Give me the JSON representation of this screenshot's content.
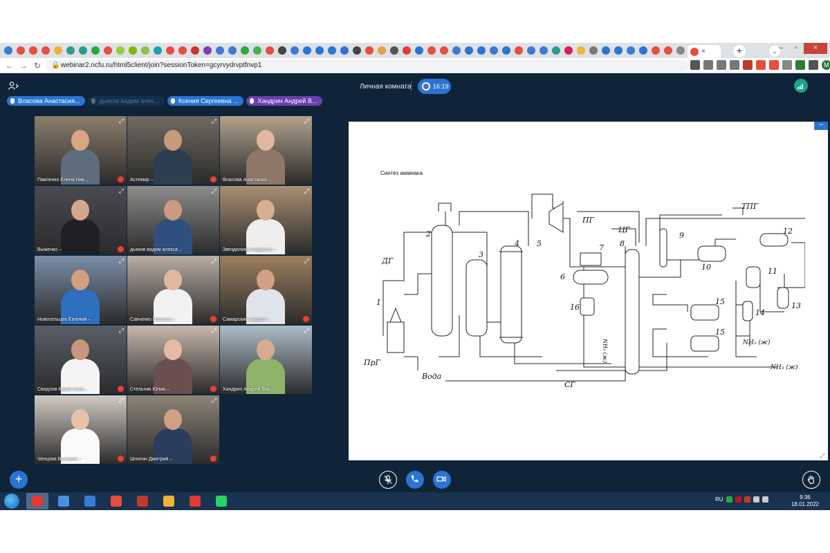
{
  "browser": {
    "tab_colors": [
      "#3b7bd4",
      "#e84d3d",
      "#e84d3d",
      "#e84d3d",
      "#f2b233",
      "#2a9d8f",
      "#2a9d8f",
      "#28a745",
      "#e84d3d",
      "#9acd32",
      "#7fba00",
      "#8bc34a",
      "#17a2b8",
      "#e84d3d",
      "#e84d3d",
      "#c0392b",
      "#7b3fb0",
      "#3e7ad3",
      "#3e7ad3",
      "#28a745",
      "#4caf50",
      "#e84d3d",
      "#444444",
      "#3b7bd4",
      "#2a74d3",
      "#2a74d3",
      "#2a74d3",
      "#2a74d3",
      "#444444",
      "#e84d3d",
      "#e8a13d",
      "#555555",
      "#e53935",
      "#2a74d3",
      "#e84d3d",
      "#e84d3d",
      "#3b7bd4",
      "#2a74d3",
      "#2a74d3",
      "#3b7bd4",
      "#2a74d3",
      "#e84d3d",
      "#3b7bd4",
      "#3b7bd4",
      "#2a9d8f",
      "#d81b60",
      "#f2b233",
      "#777777",
      "#2a74d3",
      "#2a74d3",
      "#3b7bd4",
      "#2a74d3",
      "#e84d3d",
      "#e84d3d",
      "#888888"
    ],
    "tab_close": "×",
    "new_tab": "+",
    "tab_search": "⌄",
    "win_min": "–",
    "win_max": "▫",
    "win_close": "×",
    "back": "←",
    "forward": "→",
    "reload": "↻",
    "lock": "🔒",
    "url": "webinar2.ncfu.ru/html5client/join?sessionToken=gcyrvydrvptfnvp1",
    "ext_colors": [
      "#555555",
      "#777777",
      "#777777",
      "#777777",
      "#c0392b",
      "#e84d3d",
      "#e84d3d",
      "#888888",
      "#2e7d32",
      "#555555"
    ],
    "profile_initial": "M"
  },
  "app": {
    "room_title": "Личная комната",
    "timer": "16:19",
    "speakers": [
      {
        "name": "Власова Анастасия...",
        "color": "#2a74d3",
        "dim": false
      },
      {
        "name": "дьяков вадим алек...",
        "color": "#13304b",
        "dim": true
      },
      {
        "name": "Ксения Сергеевна ...",
        "color": "#2a74d3",
        "dim": false
      },
      {
        "name": "Хандрин Андрей В...",
        "color": "#6a3fb0",
        "dim": false
      }
    ],
    "tiles": [
      {
        "name": "Павленко Елена Ник...",
        "muted": true,
        "selected": false,
        "bg": "#8b7d6b",
        "skin": "#d9a585",
        "shirt": "#5d6d7e"
      },
      {
        "name": "Астемир –",
        "muted": true,
        "selected": false,
        "bg": "#6f6a61",
        "skin": "#c79b7a",
        "shirt": "#2c3e50"
      },
      {
        "name": "Власова Анастасия ...",
        "muted": false,
        "selected": true,
        "bg": "#b3a28e",
        "skin": "#e0b8a0",
        "shirt": "#8e7766"
      },
      {
        "name": "Выженко –",
        "muted": true,
        "selected": false,
        "bg": "#4a4a52",
        "skin": "#d4a68a",
        "shirt": "#1f1f25"
      },
      {
        "name": "дьяков вадим алекса...",
        "muted": false,
        "selected": false,
        "bg": "#8c8c8a",
        "skin": "#c99a80",
        "shirt": "#2f4f7f"
      },
      {
        "name": "Звездилина Людмила –",
        "muted": false,
        "selected": false,
        "bg": "#a98f73",
        "skin": "#d8ae93",
        "shirt": "#eeeeee"
      },
      {
        "name": "Новосельцев Евгений –",
        "muted": false,
        "selected": false,
        "bg": "#7c8fa8",
        "skin": "#d1a080",
        "shirt": "#2f6fbf"
      },
      {
        "name": "Савченко Наталья –",
        "muted": true,
        "selected": false,
        "bg": "#b9aea4",
        "skin": "#e1b89d",
        "shirt": "#f2f2f2"
      },
      {
        "name": "Самарский Андрей –",
        "muted": true,
        "selected": false,
        "bg": "#9d7f60",
        "skin": "#d3a184",
        "shirt": "#dfe3ea"
      },
      {
        "name": "Свидлов Юрий Алек...",
        "muted": true,
        "selected": false,
        "bg": "#5a5f68",
        "skin": "#c8967c",
        "shirt": "#f4f4f4"
      },
      {
        "name": "Стельник Юлия –",
        "muted": true,
        "selected": false,
        "bg": "#c9b7ab",
        "skin": "#e4bca4",
        "shirt": "#6b4e4e"
      },
      {
        "name": "Хандрин Андрей Вик...",
        "muted": false,
        "selected": true,
        "bg": "#aebcc9",
        "skin": "#d7ab90",
        "shirt": "#8fb36a"
      },
      {
        "name": "Ченцова Валерия –",
        "muted": true,
        "selected": false,
        "bg": "#d2cbc4",
        "skin": "#e6c2a8",
        "shirt": "#fafafa"
      },
      {
        "name": "Шпятин Дмитрий –",
        "muted": true,
        "selected": false,
        "bg": "#8e8677",
        "skin": "#d0a083",
        "shirt": "#2b3d5c"
      }
    ]
  },
  "slide": {
    "title": "Синтез аммиака",
    "minimize": "–",
    "fullscreen": "⤢",
    "labels": {
      "dg": "ДГ",
      "prg": "ПрГ",
      "voda": "Вода",
      "pg": "ПГ",
      "cg": "ЦГ",
      "tpg": "ТПГ",
      "sg": "СГ",
      "nh3_liq": "NH₃ (ж)",
      "n1": "1",
      "n2": "2",
      "n3": "3",
      "n4": "4",
      "n5": "5",
      "n6": "6",
      "n7": "7",
      "n8": "8",
      "n9": "9",
      "n10": "10",
      "n11": "11",
      "n12": "12",
      "n13": "13",
      "n14": "14",
      "n15": "15",
      "n16": "16"
    }
  },
  "taskbar": {
    "apps": [
      "#e53935",
      "#4a90e2",
      "#3a7bd5",
      "#e84d3d",
      "#c0392b",
      "#f2b233",
      "#e53935",
      "#25d366"
    ],
    "lang": "RU",
    "tray_colors": [
      "#28a745",
      "#b71c1c",
      "#c0392b",
      "#cccccc",
      "#cccccc"
    ],
    "time": "9:36",
    "date": "18.01.2022"
  }
}
